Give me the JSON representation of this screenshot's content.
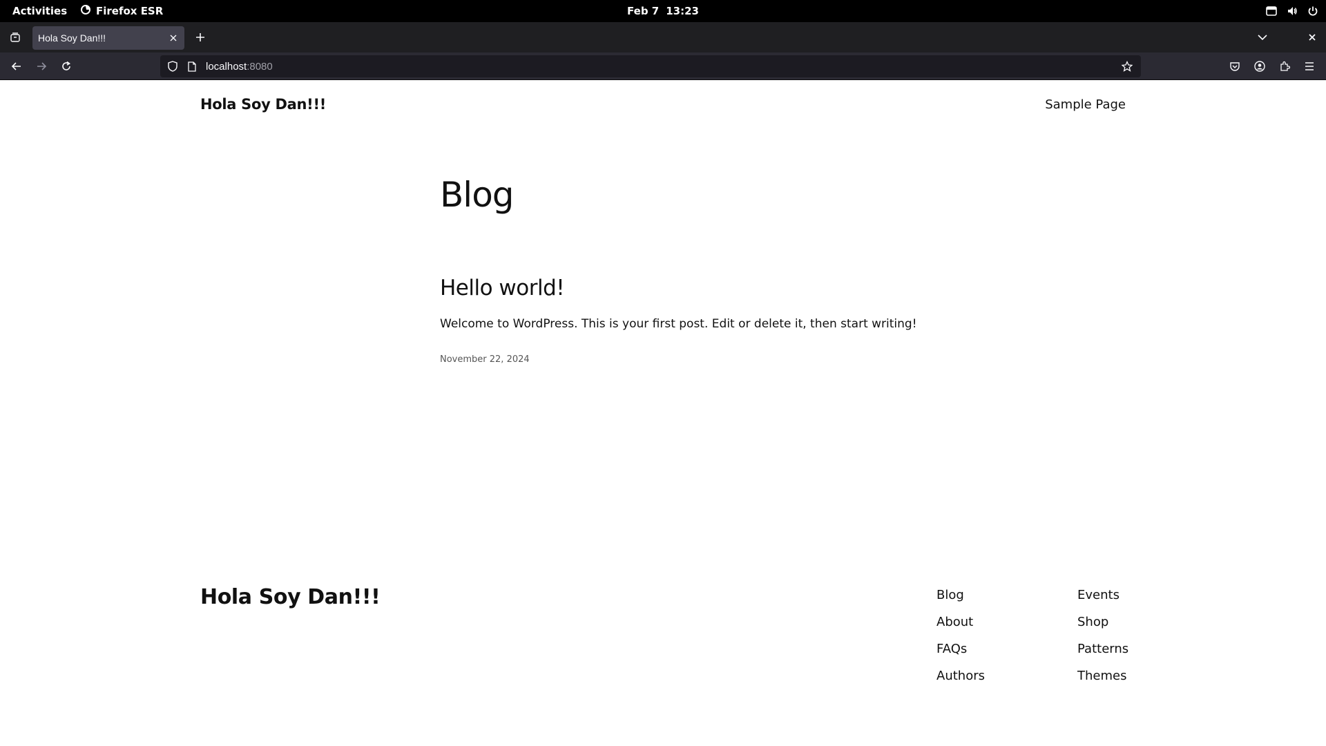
{
  "system_bar": {
    "activities": "Activities",
    "app_name": "Firefox ESR",
    "date": "Feb 7",
    "time": "13:23"
  },
  "browser": {
    "tab_title": "Hola Soy Dan!!!",
    "url_host": "localhost",
    "url_port": ":8080"
  },
  "site": {
    "title": "Hola Soy Dan!!!",
    "header_nav": [
      "Sample Page"
    ]
  },
  "main": {
    "heading": "Blog",
    "post": {
      "title": "Hello world!",
      "excerpt": "Welcome to WordPress. This is your first post. Edit or delete it, then start writing!",
      "date": "November 22, 2024"
    }
  },
  "footer": {
    "title": "Hola Soy Dan!!!",
    "nav_col1": [
      "Blog",
      "About",
      "FAQs",
      "Authors"
    ],
    "nav_col2": [
      "Events",
      "Shop",
      "Patterns",
      "Themes"
    ]
  }
}
